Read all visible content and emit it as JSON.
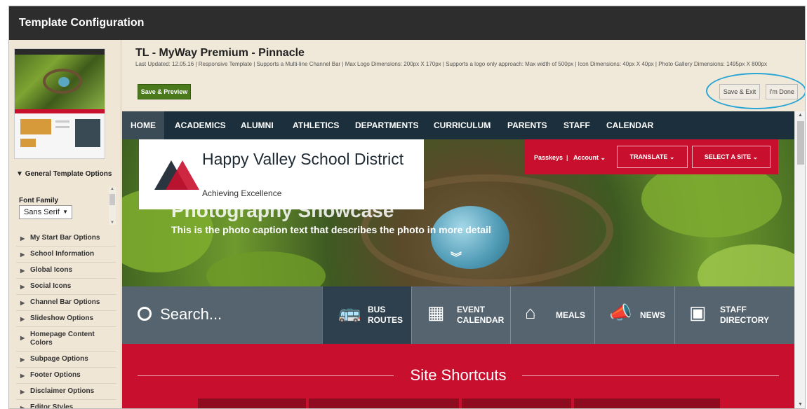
{
  "window": {
    "title": "Template Configuration"
  },
  "template": {
    "name": "TL - MyWay Premium - Pinnacle",
    "meta": "Last Updated: 12.05.16 | Responsive Template | Supports a Multi-line Channel Bar | Max Logo Dimensions: 200px X 170px | Supports a logo only approach: Max width of 500px | Icon Dimensions: 40px X 40px | Photo Gallery Dimensions: 1495px X 800px"
  },
  "buttons": {
    "save_preview": "Save & Preview",
    "save_exit": "Save & Exit",
    "im_done": "I'm Done"
  },
  "sidebar": {
    "section": "General Template Options",
    "font_family_label": "Font Family",
    "font_family_value": "Sans Serif",
    "items": [
      {
        "label": "My Start Bar Options"
      },
      {
        "label": "School Information"
      },
      {
        "label": "Global Icons"
      },
      {
        "label": "Social Icons"
      },
      {
        "label": "Channel Bar Options"
      },
      {
        "label": "Slideshow Options"
      },
      {
        "label": "Homepage Content Colors"
      },
      {
        "label": "Subpage Options"
      },
      {
        "label": "Footer Options"
      },
      {
        "label": "Disclaimer Options"
      },
      {
        "label": "Editor Styles"
      }
    ]
  },
  "preview": {
    "nav": [
      "HOME",
      "ACADEMICS",
      "ALUMNI",
      "ATHLETICS",
      "DEPARTMENTS",
      "CURRICULUM",
      "PARENTS",
      "STAFF",
      "CALENDAR"
    ],
    "school_name": "Happy Valley School District",
    "tagline": "Achieving Excellence",
    "hero_title": "Photography Showcase",
    "caption": "This is the photo caption text that describes the photo in more detail",
    "tools": {
      "passkeys": "Passkeys",
      "account": "Account",
      "translate": "TRANSLATE",
      "select_site": "SELECT A SITE"
    },
    "search_label": "Search...",
    "quick_links": [
      {
        "line1": "BUS",
        "line2": "ROUTES",
        "icon": "bus-icon"
      },
      {
        "line1": "EVENT",
        "line2": "CALENDAR",
        "icon": "calendar-icon"
      },
      {
        "line1": "MEALS",
        "line2": "",
        "icon": "milk-carton-icon"
      },
      {
        "line1": "NEWS",
        "line2": "",
        "icon": "megaphone-icon"
      },
      {
        "line1": "STAFF",
        "line2": "DIRECTORY",
        "icon": "contact-card-icon"
      }
    ],
    "shortcuts_title": "Site Shortcuts"
  },
  "colors": {
    "accent_red": "#c8102e",
    "nav_dark": "#1b2f3c",
    "save_green": "#4b7a1c",
    "highlight_circle": "#2aa6d6"
  }
}
